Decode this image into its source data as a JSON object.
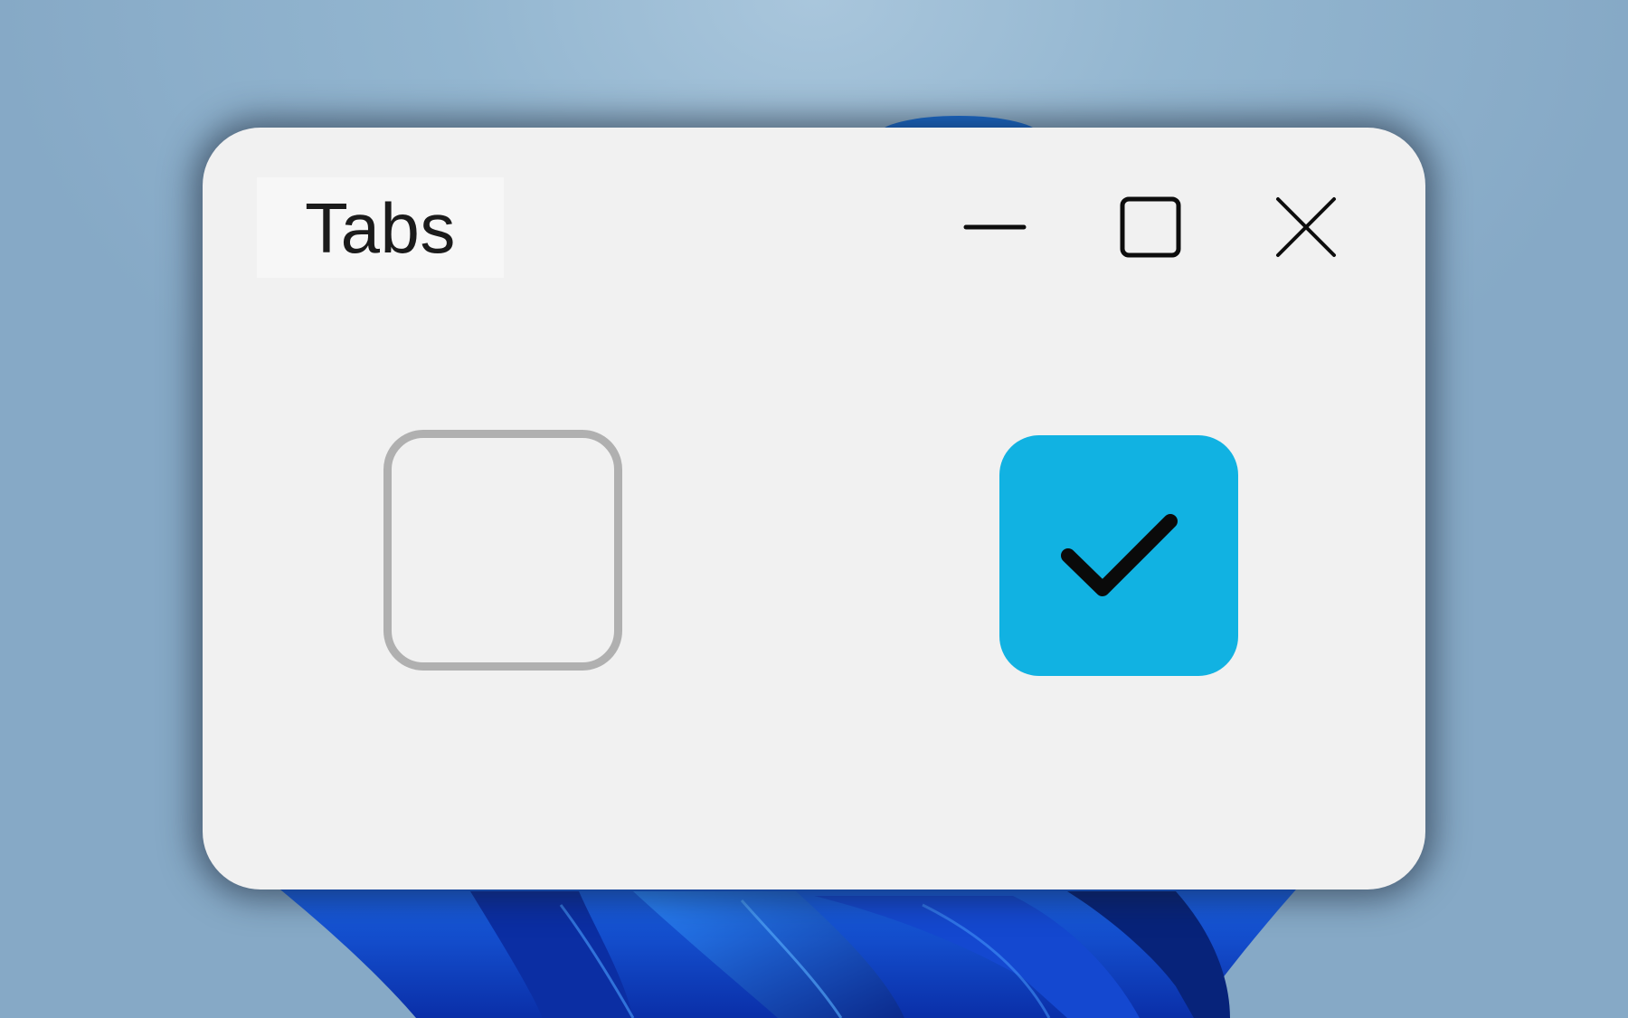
{
  "window": {
    "title": "Tabs",
    "controls": {
      "minimize_icon": "minimize-icon",
      "maximize_icon": "maximize-icon",
      "close_icon": "close-icon"
    }
  },
  "checkboxes": [
    {
      "checked": false,
      "accent": "#b0b0b0"
    },
    {
      "checked": true,
      "accent": "#11b2e2",
      "icon": "checkmark-icon"
    }
  ],
  "colors": {
    "window_background": "#f1f1f1",
    "title_chip_background": "#f7f7f7",
    "checked_fill": "#11b2e2",
    "unchecked_border": "#b0b0b0"
  }
}
